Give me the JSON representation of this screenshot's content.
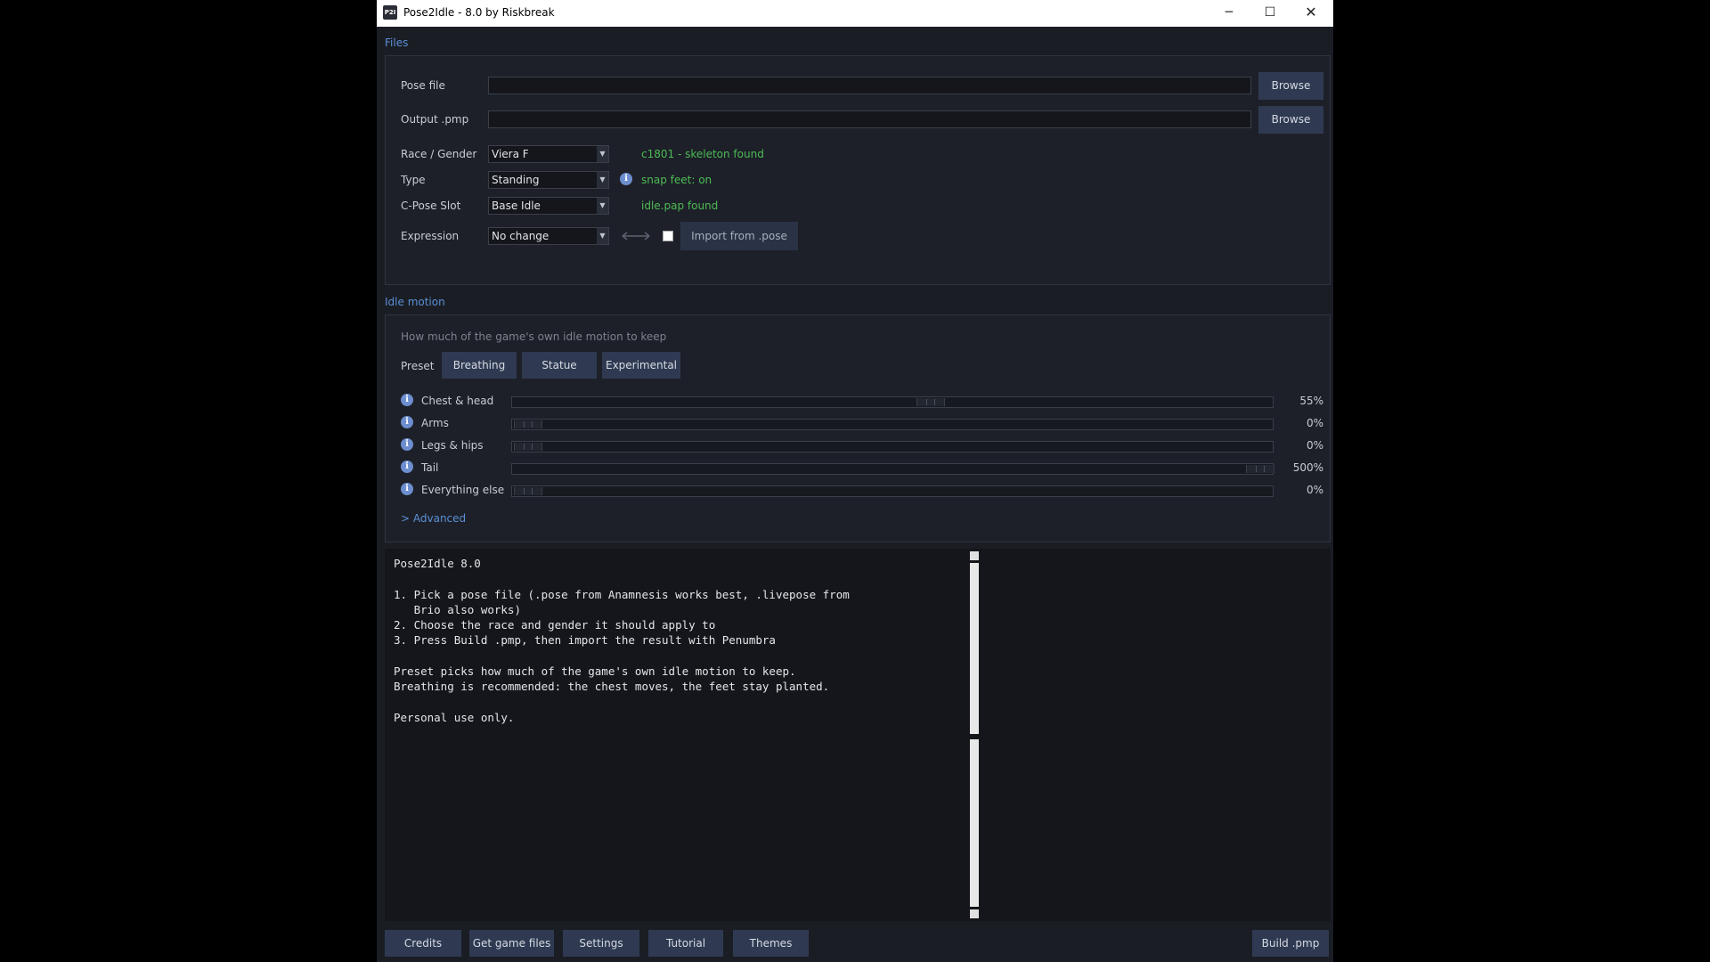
{
  "window": {
    "title": "Pose2Idle - 8.0 by Riskbreak",
    "icon_text": "P2I",
    "controls": {
      "minimize": "─",
      "maximize": "☐",
      "close": "✕"
    }
  },
  "files": {
    "section_title": "Files",
    "pose_file": {
      "label": "Pose file",
      "value": "",
      "button": "Browse"
    },
    "output_pmp": {
      "label": "Output .pmp",
      "value": "",
      "button": "Browse"
    },
    "race_gender": {
      "label": "Race / Gender",
      "value": "Viera F",
      "status": "c1801 - skeleton found"
    },
    "type": {
      "label": "Type",
      "value": "Standing",
      "status": "snap feet: on"
    },
    "cpose_slot": {
      "label": "C-Pose Slot",
      "value": "Base Idle",
      "status": "idle.pap found"
    },
    "expression": {
      "label": "Expression",
      "value": "No change",
      "import_button": "Import from .pose",
      "checkbox_checked": false
    }
  },
  "idle_motion": {
    "section_title": "Idle motion",
    "hint": "How much of the game's own idle motion to keep",
    "preset_label": "Preset",
    "presets": [
      "Breathing",
      "Statue",
      "Experimental"
    ],
    "sliders": [
      {
        "label": "Chest & head",
        "value": "55%",
        "fraction": 0.55
      },
      {
        "label": "Arms",
        "value": "0%",
        "fraction": 0.0
      },
      {
        "label": "Legs & hips",
        "value": "0%",
        "fraction": 0.0
      },
      {
        "label": "Tail",
        "value": "500%",
        "fraction": 1.0
      },
      {
        "label": "Everything else",
        "value": "0%",
        "fraction": 0.0
      }
    ],
    "advanced_label": "> Advanced"
  },
  "log": {
    "text": "Pose2Idle 8.0\n\n1. Pick a pose file (.pose from Anamnesis works best, .livepose from\n   Brio also works)\n2. Choose the race and gender it should apply to\n3. Press Build .pmp, then import the result with Penumbra\n\nPreset picks how much of the game's own idle motion to keep.\nBreathing is recommended: the chest moves, the feet stay planted.\n\nPersonal use only."
  },
  "bottom_bar": {
    "credits": "Credits",
    "get_game_files": "Get game files",
    "settings": "Settings",
    "tutorial": "Tutorial",
    "themes": "Themes",
    "build": "Build .pmp"
  },
  "colors": {
    "accent": "#5b8fd6",
    "status_ok": "#4dbb55",
    "button_bg": "#2f3a52",
    "window_bg": "#1a1d24"
  }
}
